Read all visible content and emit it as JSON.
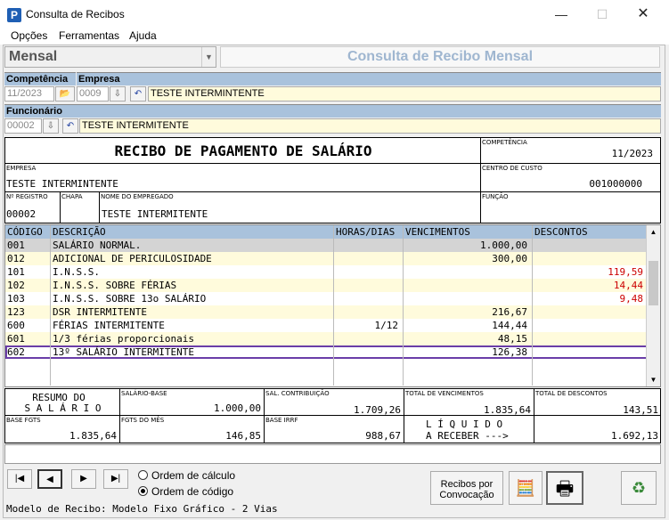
{
  "window": {
    "title": "Consulta de Recibos",
    "icon": "P"
  },
  "menu": [
    "Opções",
    "Ferramentas",
    "Ajuda"
  ],
  "mode": {
    "selected": "Mensal"
  },
  "header_title": "Consulta de Recibo Mensal",
  "labels": {
    "competencia": "Competência",
    "empresa": "Empresa",
    "funcionario": "Funcionário"
  },
  "filters": {
    "competencia": "11/2023",
    "empresa_code": "0009",
    "empresa_name": "TESTE INTERMINTENTE",
    "funcionario_code": "00002",
    "funcionario_name": "TESTE INTERMITENTE"
  },
  "recibo": {
    "title": "RECIBO DE PAGAMENTO DE SALÁRIO",
    "competencia_cap": "COMPETÊNCIA",
    "competencia": "11/2023",
    "empresa_cap": "EMPRESA",
    "empresa": "TESTE INTERMINTENTE",
    "centro_cap": "CENTRO DE CUSTO",
    "centro": "001000000",
    "registro_cap": "Nº REGISTRO",
    "registro": "00002",
    "chapa_cap": "CHAPA",
    "chapa": "",
    "nome_cap": "NOME DO EMPREGADO",
    "nome": "TESTE INTERMITENTE",
    "funcao_cap": "FUNÇÃO",
    "funcao": ""
  },
  "grid": {
    "headers": [
      "CÓDIGO",
      "DESCRIÇÃO",
      "HORAS/DIAS",
      "VENCIMENTOS",
      "DESCONTOS"
    ],
    "rows": [
      {
        "codigo": "001",
        "descricao": "SALÁRIO NORMAL.",
        "horas": "",
        "venc": "1.000,00",
        "desc": ""
      },
      {
        "codigo": "012",
        "descricao": "ADICIONAL DE PERICULOSIDADE",
        "horas": "",
        "venc": "300,00",
        "desc": ""
      },
      {
        "codigo": "101",
        "descricao": "I.N.S.S.",
        "horas": "",
        "venc": "",
        "desc": "119,59"
      },
      {
        "codigo": "102",
        "descricao": "I.N.S.S. SOBRE FÉRIAS",
        "horas": "",
        "venc": "",
        "desc": "14,44"
      },
      {
        "codigo": "103",
        "descricao": "I.N.S.S. SOBRE 13o SALÁRIO",
        "horas": "",
        "venc": "",
        "desc": "9,48"
      },
      {
        "codigo": "123",
        "descricao": "DSR INTERMITENTE",
        "horas": "",
        "venc": "216,67",
        "desc": ""
      },
      {
        "codigo": "600",
        "descricao": "FÉRIAS INTERMITENTE",
        "horas": "1/12",
        "venc": "144,44",
        "desc": ""
      },
      {
        "codigo": "601",
        "descricao": "1/3 férias proporcionais",
        "horas": "",
        "venc": "48,15",
        "desc": ""
      },
      {
        "codigo": "602",
        "descricao": "13º SALÁRIO INTERMITENTE",
        "horas": "",
        "venc": "126,38",
        "desc": ""
      }
    ]
  },
  "totals": {
    "resumo_line1": "RESUMO DO",
    "resumo_line2": "S A L Á R I O",
    "salario_base_cap": "SALÁRIO-BASE",
    "salario_base": "1.000,00",
    "sal_contrib_cap": "SAL. CONTRIBUIÇÃO",
    "sal_contrib": "1.709,26",
    "total_venc_cap": "TOTAL DE VENCIMENTOS",
    "total_venc": "1.835,64",
    "total_desc_cap": "TOTAL DE DESCONTOS",
    "total_desc": "143,51",
    "base_fgts_cap": "BASE FGTS",
    "base_fgts": "1.835,64",
    "fgts_mes_cap": "FGTS DO MÊS",
    "fgts_mes": "146,85",
    "base_irrf_cap": "BASE IRRF",
    "base_irrf": "988,67",
    "liquido_line1": "L Í Q U I D O",
    "liquido_line2": "A RECEBER --->",
    "liquido": "1.692,13"
  },
  "options": {
    "ordem_calculo": "Ordem de cálculo",
    "ordem_codigo": "Ordem de código"
  },
  "buttons": {
    "recibos_line1": "Recibos por",
    "recibos_line2": "Convocação"
  },
  "footer": "Modelo de Recibo: Modelo Fixo Gráfico - 2 Vias",
  "colors": {
    "section_header": "#a9c2dc",
    "row_even": "#fffbdc",
    "selection_border": "#6a3da8",
    "discount_red": "#cc0000"
  }
}
